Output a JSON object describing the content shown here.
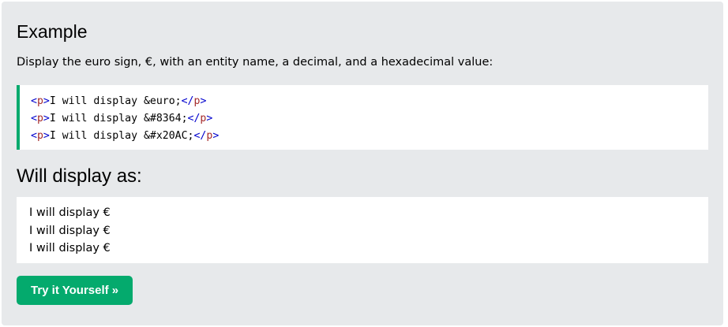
{
  "example": {
    "title": "Example",
    "description": "Display the euro sign, €, with an entity name, a decimal, and a hexadecimal value:",
    "code_lines": [
      {
        "open_lt": "<",
        "open_tag": "p",
        "open_gt": ">",
        "text": "I will display &euro;",
        "close_lt": "</",
        "close_tag": "p",
        "close_gt": ">"
      },
      {
        "open_lt": "<",
        "open_tag": "p",
        "open_gt": ">",
        "text": "I will display &#8364;",
        "close_lt": "</",
        "close_tag": "p",
        "close_gt": ">"
      },
      {
        "open_lt": "<",
        "open_tag": "p",
        "open_gt": ">",
        "text": "I will display &#x20AC;",
        "close_lt": "</",
        "close_tag": "p",
        "close_gt": ">"
      }
    ],
    "output_title": "Will display as:",
    "output_lines": [
      "I will display €",
      "I will display €",
      "I will display €"
    ],
    "try_button_label": "Try it Yourself »"
  },
  "colors": {
    "panel_background": "#e7e9eb",
    "accent_green": "#04aa6d",
    "tag_name": "#a52a2a",
    "tag_bracket": "#0000cd"
  }
}
